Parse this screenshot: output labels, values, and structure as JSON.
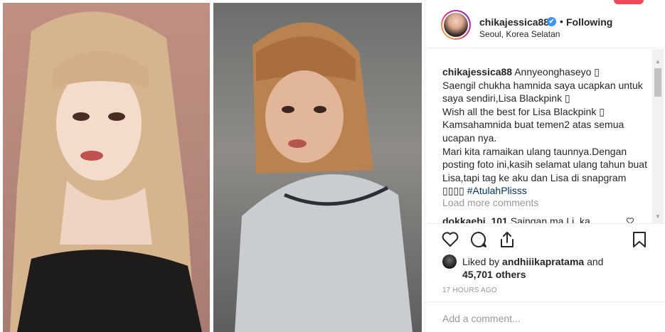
{
  "post": {
    "header": {
      "username": "chikajessica88",
      "verified_mark": "✔",
      "separator": "•",
      "follow_status": "Following",
      "location": "Seoul, Korea Selatan"
    },
    "caption": {
      "username": "chikajessica88",
      "lines": [
        " Annyeonghaseyo ▯",
        "Saengil chukha hamnida saya ucapkan untuk saya sendiri,Lisa Blackpink ▯",
        "Wish all the best for Lisa Blackpink ▯",
        "Kamsahamnida buat temen2 atas semua ucapan nya.",
        "Mari kita ramaikan ulang taunnya.Dengan posting foto ini,kasih selamat ulang tahun buat Lisa,tapi tag ke aku dan Lisa di snapgram ▯▯▯▯ "
      ],
      "hashtag": "#AtulahPlisss"
    },
    "load_more_label": "Load more comments",
    "comment_preview": {
      "username": "dokkaebi_101",
      "text": "Saingan ma Li..ka"
    },
    "likes": {
      "prefix": "Liked by ",
      "liker": "andhiiikapratama",
      "joiner": " and",
      "count_text": "45,701 others"
    },
    "timestamp": "17 HOURS AGO",
    "add_comment_placeholder": "Add a comment...",
    "icons": {
      "like": "heart-icon",
      "comment": "comment-bubble-icon",
      "share": "share-icon",
      "save": "bookmark-icon",
      "verified": "verified-badge-icon"
    },
    "colors": {
      "text": "#262626",
      "muted": "#999999",
      "link": "#003569",
      "verified": "#3897f0",
      "notification": "#ed4956"
    }
  }
}
